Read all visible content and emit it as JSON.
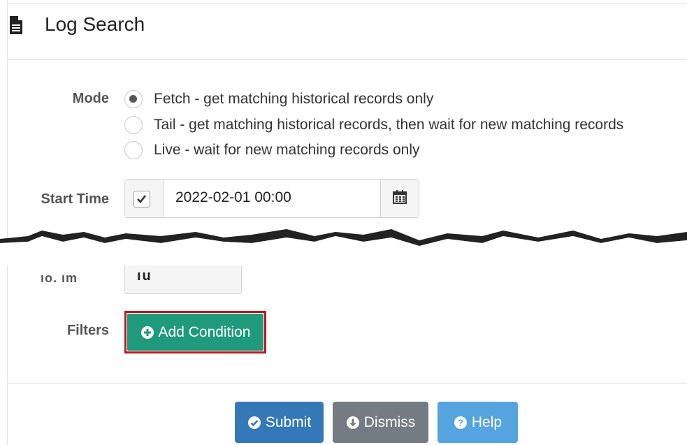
{
  "header": {
    "title": "Log Search",
    "icon": "document-icon"
  },
  "form": {
    "mode": {
      "label": "Mode",
      "options": [
        {
          "text": "Fetch - get matching historical records only",
          "checked": true
        },
        {
          "text": "Tail - get matching historical records, then wait for new matching records",
          "checked": false
        },
        {
          "text": "Live - wait for new matching records only",
          "checked": false
        }
      ]
    },
    "start_time": {
      "label": "Start Time",
      "enabled": true,
      "value": "2022-02-01 00:00",
      "icon": "calendar-icon"
    },
    "end_time_partial": {
      "label_fragment": "ıo. ım",
      "value_fragment": "ıu"
    },
    "filters": {
      "label": "Filters",
      "add_condition_label": "Add Condition",
      "icon": "plus-circle-icon"
    }
  },
  "actions": {
    "submit_label": "Submit",
    "dismiss_label": "Dismiss",
    "help_label": "Help"
  },
  "colors": {
    "add_button": "#1f9a7c",
    "highlight": "#c0171d",
    "submit": "#3478b7",
    "dismiss": "#747b82",
    "help": "#55a4e0"
  }
}
